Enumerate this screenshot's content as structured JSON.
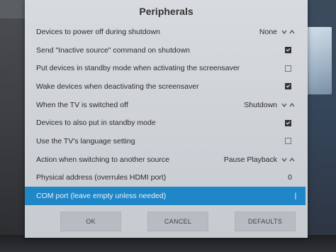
{
  "dialog": {
    "title": "Peripherals"
  },
  "rows": [
    {
      "label": "Devices to power off during shutdown",
      "type": "spinner",
      "value": "None"
    },
    {
      "label": "Send \"Inactive source\" command on shutdown",
      "type": "checkbox",
      "checked": true
    },
    {
      "label": "Put devices in standby mode when activating the screensaver",
      "type": "checkbox",
      "checked": false
    },
    {
      "label": "Wake devices when deactivating the screensaver",
      "type": "checkbox",
      "checked": true
    },
    {
      "label": "When the TV is switched off",
      "type": "spinner",
      "value": "Shutdown"
    },
    {
      "label": "Devices to also put in standby mode",
      "type": "checkbox",
      "checked": true
    },
    {
      "label": "Use the TV's language setting",
      "type": "checkbox",
      "checked": false
    },
    {
      "label": "Action when switching to another source",
      "type": "spinner",
      "value": "Pause Playback"
    },
    {
      "label": "Physical address (overrules HDMI port)",
      "type": "number",
      "value": "0"
    },
    {
      "label": "COM port (leave empty unless needed)",
      "type": "text",
      "value": "",
      "selected": true
    }
  ],
  "buttons": {
    "ok": "OK",
    "cancel": "CANCEL",
    "defaults": "DEFAULTS"
  },
  "colors": {
    "selected_row": "#1f86c8",
    "dialog_bg": "#d3d7db",
    "button_bg": "#b7bcc2"
  }
}
